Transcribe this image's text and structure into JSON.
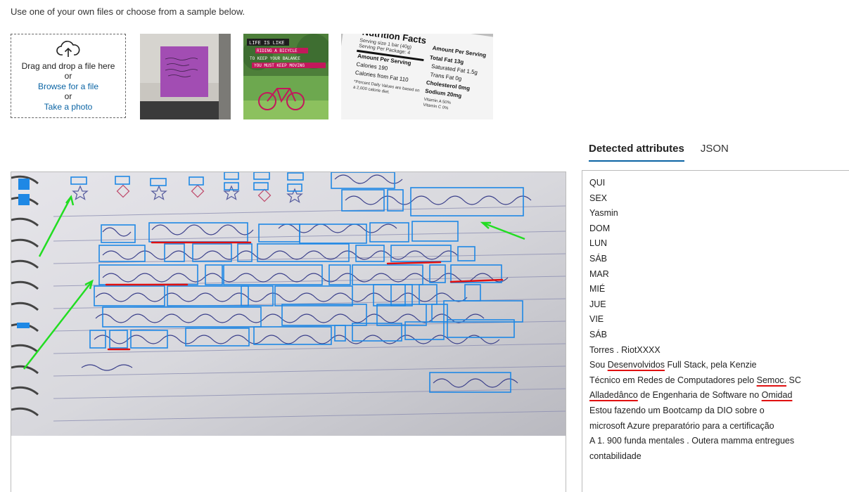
{
  "intro_text": "Use one of your own files or choose from a sample below.",
  "upload": {
    "icon": "cloud-upload-icon",
    "drag_text": "Drag and drop a file here",
    "or1": "or",
    "browse_label": "Browse for a file",
    "or2": "or",
    "photo_label": "Take a photo"
  },
  "samples": {
    "nutrition": {
      "title": "Nutrition Facts",
      "amount_per_serving": "Amount Per Serving",
      "serving_size": "Serving size 1 bar (40g)",
      "servings_per_package": "Serving Per Package: 4",
      "calories": "Calories 190",
      "calories_fat": "Calories from Fat 110",
      "daily_values": "*Percent Daily Values are based on",
      "calorie_diet": "a 2,000 calorie diet.",
      "total_fat": "Total Fat 13g",
      "saturated_fat": "Saturated Fat 1.5g",
      "trans_fat": "Trans Fat 0g",
      "cholesterol": "Cholesterol 0mg",
      "sodium": "Sodium 20mg",
      "vitamin_a": "Vitamin A 50%",
      "vitamin_c": "Vitamin C 0%"
    },
    "poster": {
      "line1": "LIFE IS LIKE",
      "line2": "RIDING A BICYCLE",
      "line3": "TO KEEP YOUR BALANCE",
      "line4": "YOU MUST KEEP MOVING"
    }
  },
  "tabs": {
    "detected": "Detected attributes",
    "json": "JSON"
  },
  "attributes": [
    "QUI",
    "SEX",
    "Yasmin",
    "DOM",
    "LUN",
    "SÁB",
    "MAR",
    "MIÉ",
    "JUE",
    "VIE",
    "SÁB",
    "Torres . RiotXXXX"
  ],
  "lines": {
    "l13a": "Sou ",
    "l13b": "Desenvolvidos",
    "l13c": " Full Stack, pela Kenzie",
    "l14a": "Técnico em Redes de Computadores pelo ",
    "l14b": "Semoc.",
    "l14c": " SC",
    "l15a": "Alladedânco",
    "l15b": " de Engenharia de Software no ",
    "l15c": "Omidad",
    "l16": "Estou fazendo um Bootcamp da DIO sobre o",
    "l17": "microsoft Azure preparatório para a certificação",
    "l18": "A 1. 900 funda mentales . Outera mamma entregues",
    "l19": "contabilidade"
  },
  "colors": {
    "accent": "#0a64a4",
    "box_blue": "#1e88e5",
    "underline_red": "#e01010",
    "arrow_green": "#22dd22"
  }
}
